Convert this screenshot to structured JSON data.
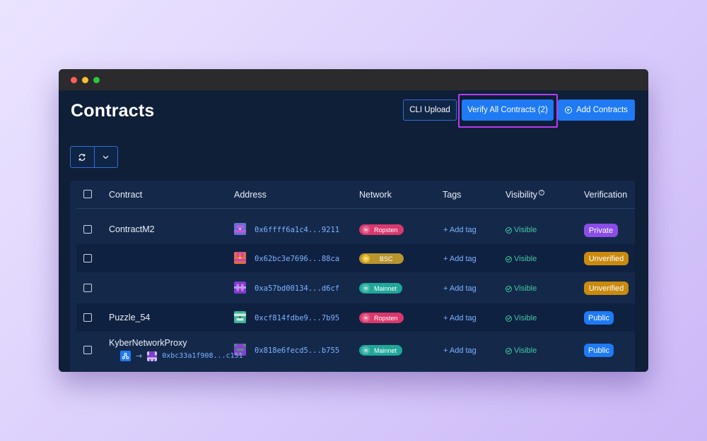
{
  "window": {
    "controls": [
      "close",
      "minimize",
      "maximize"
    ]
  },
  "page": {
    "title": "Contracts"
  },
  "toolbar": {
    "cli_upload_label": "CLI Upload",
    "verify_all_label": "Verify All Contracts (2)",
    "add_contracts_label": "Add Contracts"
  },
  "table": {
    "headers": {
      "contract": "Contract",
      "address": "Address",
      "network": "Network",
      "tags": "Tags",
      "visibility": "Visibility",
      "verification": "Verification"
    },
    "rows": [
      {
        "name": "ContractM2",
        "address": "0x6ffff6a1c4...9211",
        "network": "Ropsten",
        "tag_action": "+ Add tag",
        "visibility": "Visible",
        "verification": "Private"
      },
      {
        "name": "",
        "address": "0x62bc3e7696...88ca",
        "network": "BSC",
        "tag_action": "+ Add tag",
        "visibility": "Visible",
        "verification": "Unverified"
      },
      {
        "name": "",
        "address": "0xa57bd00134...d6cf",
        "network": "Mainnet",
        "tag_action": "+ Add tag",
        "visibility": "Visible",
        "verification": "Unverified"
      },
      {
        "name": "Puzzle_54",
        "address": "0xcf814fdbe9...7b95",
        "network": "Ropsten",
        "tag_action": "+ Add tag",
        "visibility": "Visible",
        "verification": "Public"
      },
      {
        "name": "KyberNetworkProxy",
        "address": "0x818e6fecd5...b755",
        "network": "Mainnet",
        "tag_action": "+ Add tag",
        "visibility": "Visible",
        "verification": "Public",
        "proxy_address": "0xbc33a1f908...c151"
      }
    ]
  },
  "colors": {
    "ropsten": "#d9386f",
    "bsc": "#b8952f",
    "mainnet": "#1fa89a",
    "private": "#8a4de8",
    "unverified": "#c98a0e",
    "public": "#1f7af4",
    "accent": "#1f7af4",
    "highlight": "#b63cf0"
  },
  "icons": [
    "refresh-icon",
    "chevron-down-icon",
    "add-circle-icon",
    "info-icon",
    "network-icon",
    "check-circle-icon",
    "proxy-icon",
    "arrow-right-icon"
  ]
}
